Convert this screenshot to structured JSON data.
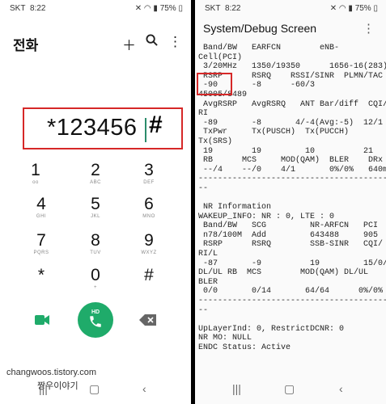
{
  "status_bar": {
    "carrier": "SKT",
    "time": "8:22",
    "battery": "75%"
  },
  "dialer": {
    "title": "전화",
    "entered_number": "*123456",
    "hash": "#",
    "keys": [
      {
        "digit": "1",
        "letters": ""
      },
      {
        "digit": "2",
        "letters": "ABC"
      },
      {
        "digit": "3",
        "letters": "DEF"
      },
      {
        "digit": "4",
        "letters": "GHI"
      },
      {
        "digit": "5",
        "letters": "JKL"
      },
      {
        "digit": "6",
        "letters": "MNO"
      },
      {
        "digit": "7",
        "letters": "PQRS"
      },
      {
        "digit": "8",
        "letters": "TUV"
      },
      {
        "digit": "9",
        "letters": "WXYZ"
      },
      {
        "digit": "*",
        "letters": ""
      },
      {
        "digit": "0",
        "letters": "+"
      },
      {
        "digit": "#",
        "letters": ""
      }
    ],
    "call_label": "HD",
    "watermark": "changwoos.tistory.com",
    "watermark2": "짱우이야기"
  },
  "debug": {
    "title": "System/Debug Screen",
    "console_text": " Band/BW   EARFCN        eNB-\nCell(PCI)\n 3/20MHz   1350/19350      1656-16(283)\n RSRP      RSRQ    RSSI/SINR  PLMN/TAC\n -90       -8      -60/3\n45005/8489\n AvgRSRP   AvgRSRQ   ANT Bar/diff  CQI/\nRI\n -89       -8       4/-4(Avg:-5)  12/1\n TxPwr     Tx(PUSCH)  Tx(PUCCH)\nTx(SRS)\n 19        19         10          21\n RB      MCS     MOD(QAM)  BLER    DRx\n --/4    --/0    4/1       0%/0%   640ms\n-----------------------------------------\n--\n\n NR Information\nWAKEUP_INFO: NR : 0, LTE : 0\n Band/BW   SCG         NR-ARFCN   PCI\n n78/100M  Add         643488     905\n RSRP      RSRQ        SSB-SINR   CQI/\nRI/L\n -87       -9          19         15/0/0\nDL/UL RB  MCS        MOD(QAM) DL/UL\nBLER\n 0/0       0/14       64/64      0%/0%\n-----------------------------------------\n--\n\nUpLayerInd: 0, RestrictDCNR: 0\nNR MO: NULL\nENDC Status: Active"
  },
  "colors": {
    "highlight": "#d62828",
    "call_green": "#1fab6a",
    "cursor": "#2b8c6b"
  }
}
